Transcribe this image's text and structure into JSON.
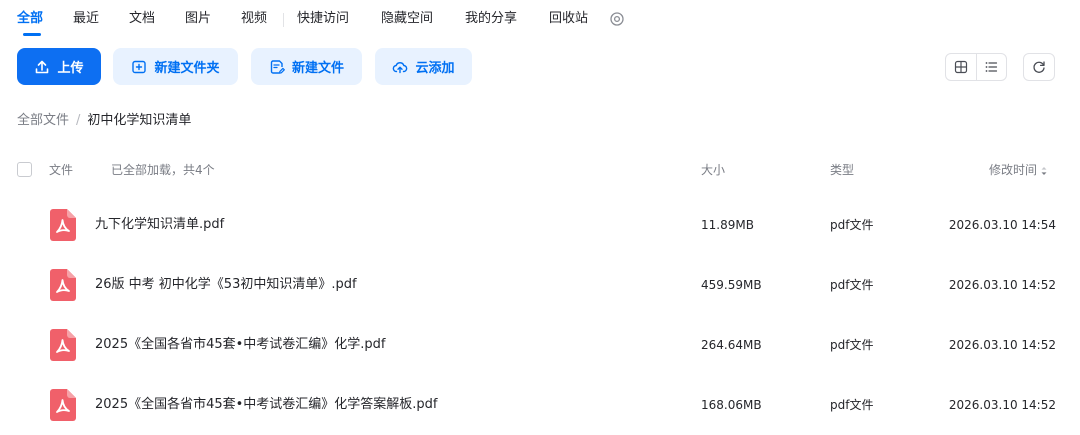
{
  "tabs": [
    {
      "label": "全部",
      "active": true
    },
    {
      "label": "最近"
    },
    {
      "label": "文档"
    },
    {
      "label": "图片"
    },
    {
      "label": "视频"
    },
    {
      "label": "快捷访问"
    },
    {
      "label": "隐藏空间"
    },
    {
      "label": "我的分享"
    },
    {
      "label": "回收站"
    }
  ],
  "toolbar": {
    "upload_label": "上传",
    "new_folder_label": "新建文件夹",
    "new_file_label": "新建文件",
    "cloud_add_label": "云添加"
  },
  "breadcrumb": {
    "root": "全部文件",
    "separator": "/",
    "current": "初中化学知识清单"
  },
  "table": {
    "header": {
      "name": "文件",
      "status": "已全部加载，共4个",
      "size": "大小",
      "type": "类型",
      "modified": "修改时间"
    },
    "rows": [
      {
        "name": "九下化学知识清单.pdf",
        "size": "11.89MB",
        "type": "pdf文件",
        "modified": "2026.03.10 14:54"
      },
      {
        "name": "26版 中考 初中化学《53初中知识清单》.pdf",
        "size": "459.59MB",
        "type": "pdf文件",
        "modified": "2026.03.10 14:52"
      },
      {
        "name": "2025《全国各省市45套•中考试卷汇编》化学.pdf",
        "size": "264.64MB",
        "type": "pdf文件",
        "modified": "2026.03.10 14:52"
      },
      {
        "name": "2025《全国各省市45套•中考试卷汇编》化学答案解板.pdf",
        "size": "168.06MB",
        "type": "pdf文件",
        "modified": "2026.03.10 14:52"
      }
    ]
  },
  "icons": {
    "tab_more": "settings-circle-icon",
    "upload": "upload-icon",
    "new_folder": "folder-plus-icon",
    "new_file": "file-edit-icon",
    "cloud_add": "cloud-upload-icon",
    "grid_view": "grid-view-icon",
    "list_view": "list-view-icon",
    "refresh": "refresh-icon",
    "file": "pdf-file-icon",
    "sort": "sort-desc-icon"
  },
  "colors": {
    "accent": "#0070f3",
    "primary_button": "#0d6ff2",
    "light_button": "#e8f2ff",
    "pdf_icon": "#f0606a"
  }
}
